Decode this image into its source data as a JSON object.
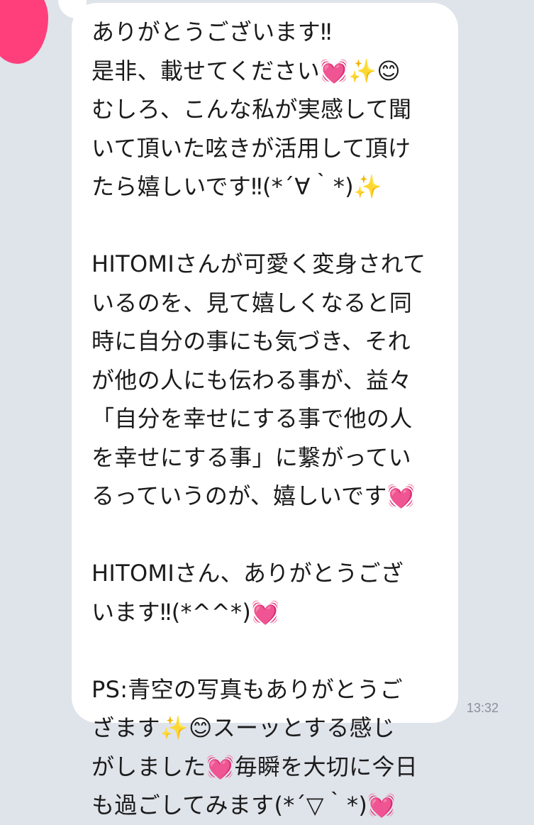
{
  "chat": {
    "message": {
      "lines": [
        "ありがとうございます‼︎",
        "是非、載せてください💓✨😊",
        "むしろ、こんな私が実感して聞",
        "いて頂いた呟きが活用して頂け",
        "たら嬉しいです‼︎(*´∀｀*)✨",
        "",
        "HITOMIさんが可愛く変身されて",
        "いるのを、見て嬉しくなると同",
        "時に自分の事にも気づき、それ",
        "が他の人にも伝わる事が、益々",
        "「自分を幸せにする事で他の人",
        "を幸せにする事」に繋がってい",
        "るっていうのが、嬉しいです💓",
        "",
        "HITOMIさん、ありがとうござ",
        "います‼︎(*^^*)💓",
        "",
        "PS:青空の写真もありがとうご",
        "ざます✨😊スーッとする感じ",
        "がしました💓毎瞬を大切に今日",
        "も過ごしてみます(*´▽｀*)💓"
      ],
      "timestamp": "13:32"
    },
    "avatar_color": "#ff3f7c",
    "background_color": "#dfe3ea",
    "bubble_color": "#ffffff"
  }
}
